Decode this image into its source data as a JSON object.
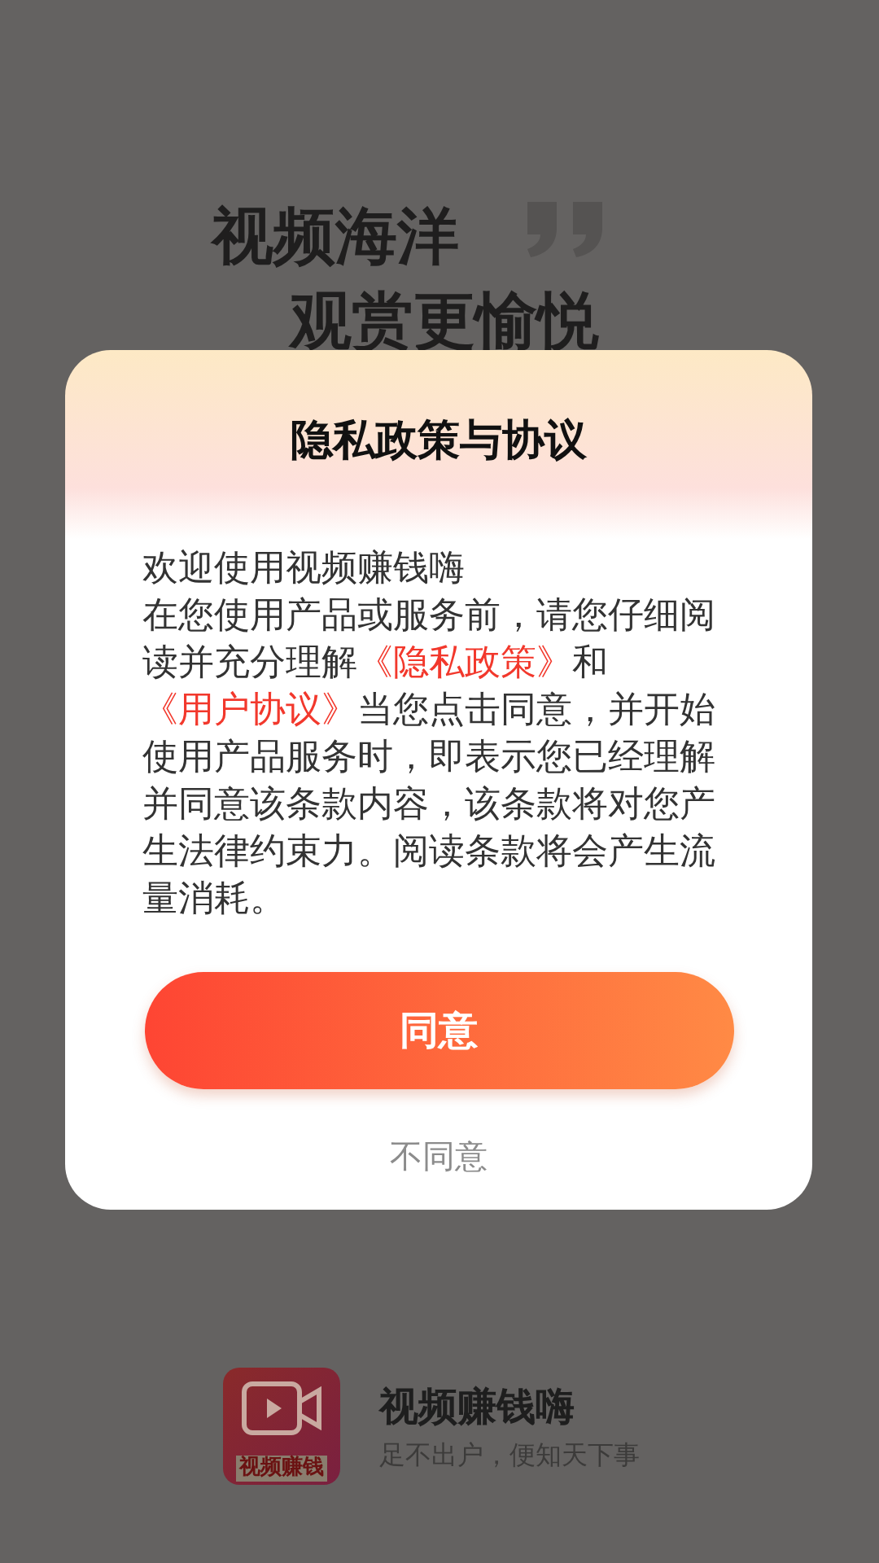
{
  "splash": {
    "slogan_lines": [
      "视频海洋",
      "观赏更愉悦"
    ],
    "app_icon_text": "视频赚钱",
    "app_name": "视频赚钱嗨",
    "tagline": "足不出户，便知天下事"
  },
  "dialog": {
    "title": "隐私政策与协议",
    "greeting": "欢迎使用视频赚钱嗨",
    "segments": [
      {
        "kind": "text",
        "text": "在您使用产品或服务前，请您仔细阅读并充分理解"
      },
      {
        "kind": "link",
        "text": "《隐私政策》"
      },
      {
        "kind": "text",
        "text": "和"
      },
      {
        "kind": "link",
        "text": "《用户协议》"
      },
      {
        "kind": "text",
        "text": "当您点击同意，并开始使用产品服务时，即表示您已经理解并同意该条款内容，该条款将对您产生法律约束力。阅读条款将会产生流量消耗。"
      }
    ],
    "buttons": [
      {
        "kind": "primary",
        "label": "同意"
      },
      {
        "kind": "plain",
        "label": "不同意"
      }
    ]
  }
}
